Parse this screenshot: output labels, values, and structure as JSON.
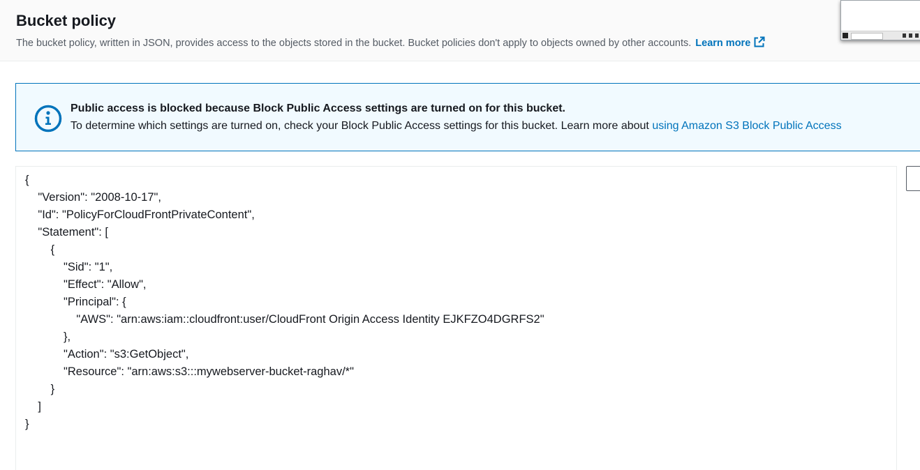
{
  "header": {
    "title": "Bucket policy",
    "description": "The bucket policy, written in JSON, provides access to the objects stored in the bucket. Bucket policies don't apply to objects owned by other accounts.",
    "learn_more": "Learn more"
  },
  "alert": {
    "title": "Public access is blocked because Block Public Access settings are turned on for this bucket.",
    "body": "To determine which settings are turned on, check your Block Public Access settings for this bucket. Learn more about ",
    "link": "using Amazon S3 Block Public Access"
  },
  "policy_lines": [
    "{",
    "    \"Version\": \"2008-10-17\",",
    "    \"Id\": \"PolicyForCloudFrontPrivateContent\",",
    "    \"Statement\": [",
    "        {",
    "            \"Sid\": \"1\",",
    "            \"Effect\": \"Allow\",",
    "            \"Principal\": {",
    "                \"AWS\": \"arn:aws:iam::cloudfront:user/CloudFront Origin Access Identity EJKFZO4DGRFS2\"",
    "            },",
    "            \"Action\": \"s3:GetObject\",",
    "            \"Resource\": \"arn:aws:s3:::mywebserver-bucket-raghav/*\"",
    "        }",
    "    ]",
    "}"
  ],
  "colors": {
    "link": "#0073bb",
    "alert_background": "#f1faff",
    "alert_border": "#0073bb"
  },
  "icons": {
    "alert": "info-circle-icon",
    "learn_more": "external-link-icon"
  }
}
